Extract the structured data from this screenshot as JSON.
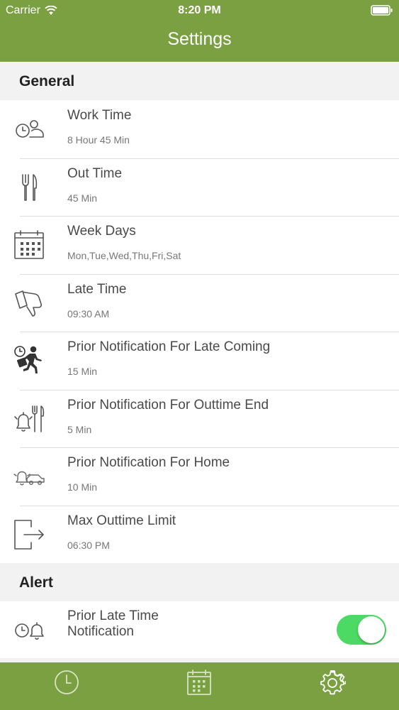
{
  "status_bar": {
    "carrier": "Carrier",
    "time": "8:20 PM",
    "wifi_icon": "wifi-icon",
    "battery_icon": "battery-icon"
  },
  "header": {
    "title": "Settings",
    "background_color": "#7aa041"
  },
  "general": {
    "section_title": "General",
    "items": [
      {
        "title": "Work Time",
        "value": "8 Hour 45 Min",
        "icon": "clock-person-icon"
      },
      {
        "title": "Out Time",
        "value": "45 Min",
        "icon": "fork-knife-icon"
      },
      {
        "title": "Week Days",
        "value": "Mon,Tue,Wed,Thu,Fri,Sat",
        "icon": "calendar-icon"
      },
      {
        "title": "Late Time",
        "value": "09:30 AM",
        "icon": "thumbs-down-icon"
      },
      {
        "title": "Prior Notification For Late Coming",
        "value": "15 Min",
        "icon": "running-man-clock-icon"
      },
      {
        "title": "Prior Notification For Outtime End",
        "value": "5 Min",
        "icon": "bell-fork-knife-icon"
      },
      {
        "title": "Prior Notification For Home",
        "value": "10 Min",
        "icon": "bell-car-icon"
      },
      {
        "title": "Max Outtime Limit",
        "value": "06:30 PM",
        "icon": "exit-icon"
      }
    ]
  },
  "alert": {
    "section_title": "Alert",
    "items": [
      {
        "title_line1": "Prior Late Time",
        "title_line2": "Notification",
        "icon": "clock-bell-icon",
        "enabled": true
      }
    ]
  },
  "tab_bar": {
    "tabs": [
      {
        "icon": "clock-icon",
        "active": false
      },
      {
        "icon": "calendar-icon",
        "active": false
      },
      {
        "icon": "gear-icon",
        "active": true
      }
    ],
    "background_color": "#7aa041"
  },
  "colors": {
    "accent": "#7aa041",
    "toggle_on": "#4cd964",
    "section_background": "#f2f2f2"
  }
}
